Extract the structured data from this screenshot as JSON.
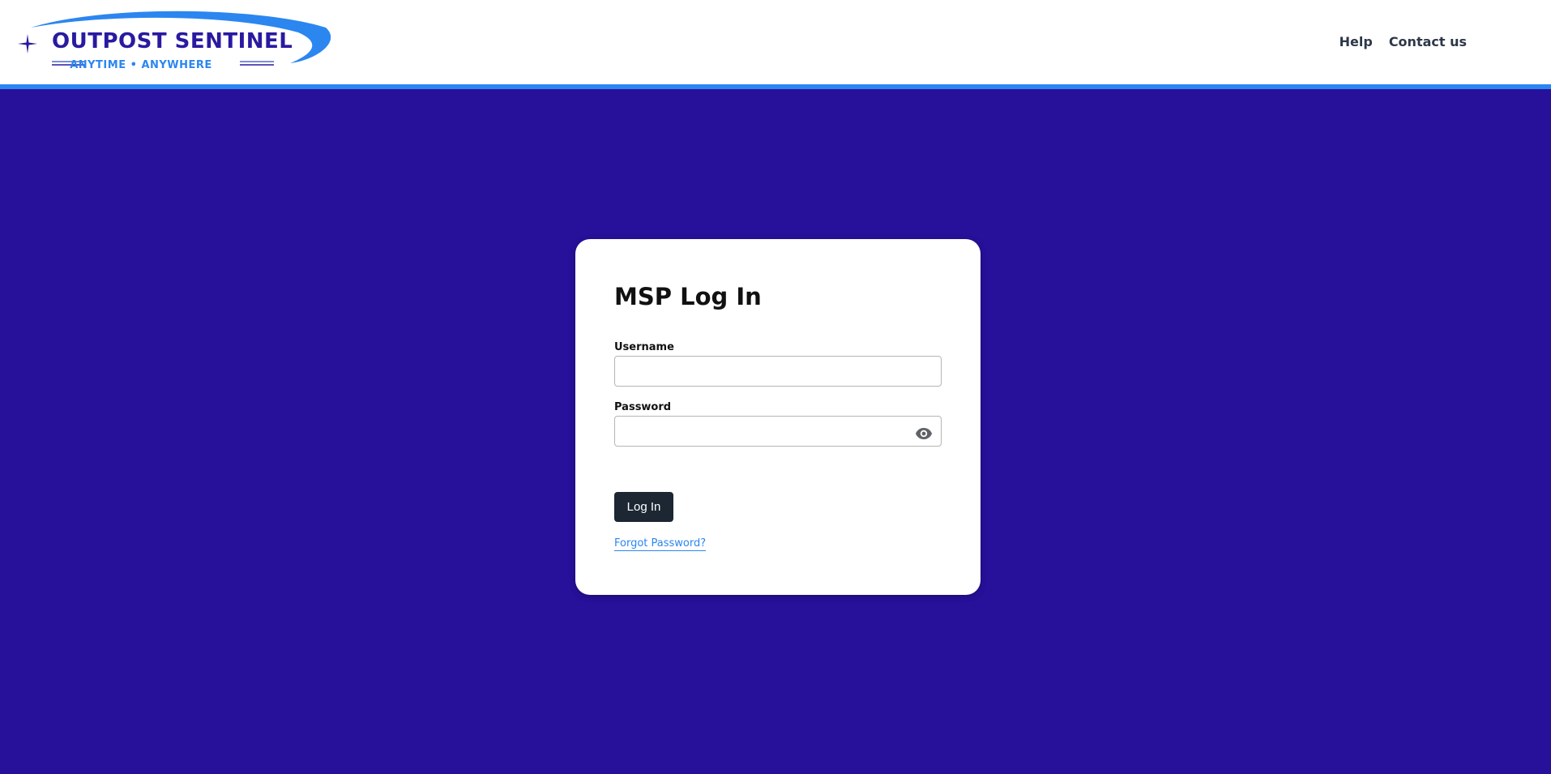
{
  "header": {
    "logo": {
      "title": "OUTPOST SENTINEL",
      "tagline": "ANYTIME • ANYWHERE",
      "icon": "sparkle-star-icon"
    },
    "nav": [
      {
        "label": "Help"
      },
      {
        "label": "Contact us"
      }
    ]
  },
  "login": {
    "title": "MSP Log In",
    "username": {
      "label": "Username",
      "value": "",
      "placeholder": ""
    },
    "password": {
      "label": "Password",
      "value": "",
      "placeholder": "",
      "toggle_icon": "eye-icon"
    },
    "submit_label": "Log In",
    "forgot_label": "Forgot Password?"
  },
  "colors": {
    "background": "#27109a",
    "header_border": "#2b86f0",
    "brand_text": "#2a1aa0",
    "accent": "#2b86f0",
    "button": "#1c2733",
    "card": "#ffffff"
  }
}
